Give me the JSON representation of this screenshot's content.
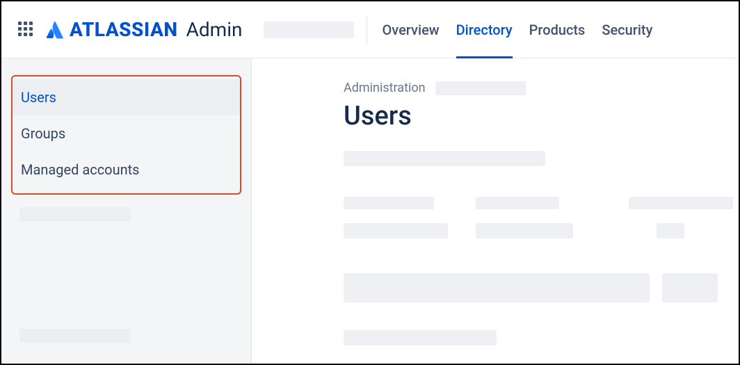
{
  "brand": {
    "company": "ATLASSIAN",
    "product": "Admin"
  },
  "topnav": {
    "items": [
      {
        "label": "Overview",
        "active": false
      },
      {
        "label": "Directory",
        "active": true
      },
      {
        "label": "Products",
        "active": false
      },
      {
        "label": "Security",
        "active": false
      }
    ]
  },
  "sidebar": {
    "items": [
      {
        "label": "Users",
        "active": true
      },
      {
        "label": "Groups",
        "active": false
      },
      {
        "label": "Managed accounts",
        "active": false
      }
    ]
  },
  "breadcrumb": {
    "root": "Administration"
  },
  "page": {
    "title": "Users"
  }
}
